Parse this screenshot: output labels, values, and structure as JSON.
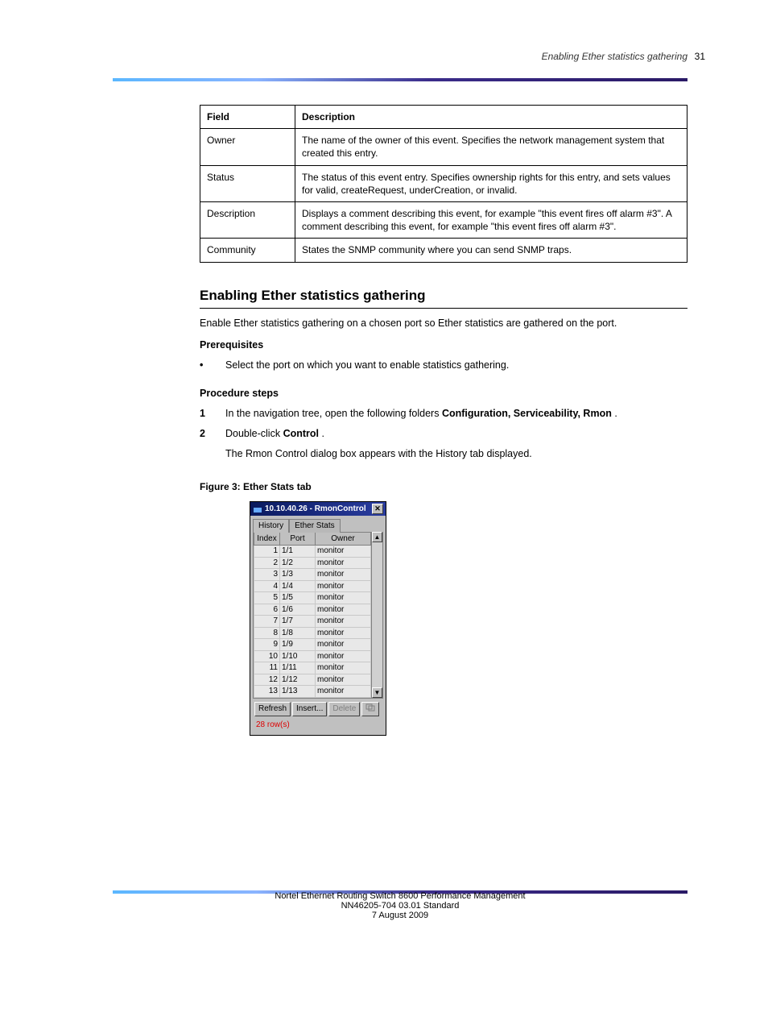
{
  "page_heading": "Enabling Ether statistics gathering",
  "def_table": {
    "headers": [
      "Field",
      "Description"
    ],
    "rows": [
      {
        "field": "Owner",
        "desc": "The name of the owner of this event. Specifies the network management system that created this entry."
      },
      {
        "field": "Status",
        "desc": "The status of this event entry. Specifies ownership rights for this entry, and sets values for valid, createRequest, underCreation, or invalid."
      },
      {
        "field": "Description",
        "desc": "Displays a comment describing this event, for example \"this event fires off alarm #3\". A comment describing this event, for example \"this event fires off alarm #3\"."
      },
      {
        "field": "Community",
        "desc": "States the SNMP community where you can send SNMP traps."
      }
    ]
  },
  "section_title": "Enabling Ether statistics gathering",
  "intro": "Enable Ether statistics gathering on a chosen port so Ether statistics are gathered on the port.",
  "prereq_title": "Prerequisites",
  "prereq_item": "Select the port on which you want to enable statistics gathering.",
  "steps_title": "Procedure steps",
  "step_1": {
    "num": "1",
    "text_1": "In the navigation tree, open the following folders ",
    "text_2": "Configuration, Serviceability, Rmon",
    "text_3": "."
  },
  "step_2": {
    "num": "2",
    "text_1": "Double-click ",
    "text_2": "Control",
    "text_3": "."
  },
  "step_result": "The Rmon Control dialog box appears with the History tab displayed.",
  "figure_caption": "Figure 3: Ether Stats tab",
  "dialog": {
    "title": "10.10.40.26 - RmonControl",
    "tabs": {
      "active": "History",
      "inactive": "Ether Stats"
    },
    "columns": [
      "Index",
      "Port",
      "Owner"
    ],
    "rows": [
      {
        "i": "1",
        "p": "1/1",
        "o": "monitor"
      },
      {
        "i": "2",
        "p": "1/2",
        "o": "monitor"
      },
      {
        "i": "3",
        "p": "1/3",
        "o": "monitor"
      },
      {
        "i": "4",
        "p": "1/4",
        "o": "monitor"
      },
      {
        "i": "5",
        "p": "1/5",
        "o": "monitor"
      },
      {
        "i": "6",
        "p": "1/6",
        "o": "monitor"
      },
      {
        "i": "7",
        "p": "1/7",
        "o": "monitor"
      },
      {
        "i": "8",
        "p": "1/8",
        "o": "monitor"
      },
      {
        "i": "9",
        "p": "1/9",
        "o": "monitor"
      },
      {
        "i": "10",
        "p": "1/10",
        "o": "monitor"
      },
      {
        "i": "11",
        "p": "1/11",
        "o": "monitor"
      },
      {
        "i": "12",
        "p": "1/12",
        "o": "monitor"
      },
      {
        "i": "13",
        "p": "1/13",
        "o": "monitor"
      }
    ],
    "buttons": {
      "refresh": "Refresh",
      "insert": "Insert...",
      "delete": "Delete"
    },
    "row_count": "28 row(s)"
  },
  "footer_left": "Nortel Ethernet Routing Switch 8600 Performance Management",
  "footer_right": "NN46205-704   03.01 Standard",
  "footer_date": "7 August 2009",
  "page_number": "31"
}
